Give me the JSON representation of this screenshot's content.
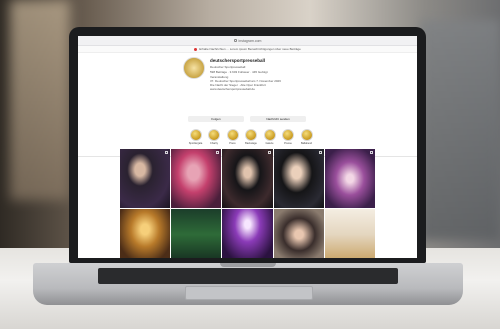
{
  "browser": {
    "url": "instagram.com"
  },
  "notice": {
    "text": "Erhalte Nachrichten ... Lorem ipsum Benachrichtigungen über neue Beiträge"
  },
  "profile": {
    "username": "deutschersportpresseball",
    "verified": true,
    "lines": [
      "Deutscher Sportpresseball",
      "598 Beiträge · 3.603 Follower · 445 Gefolgt",
      "Veranstaltung",
      "37. Deutscher Sportpresseball am 7. November 2026",
      "Die Nacht der Sieger · Alte Oper Frankfurt",
      "www.deutschersportpresseball.de"
    ],
    "follow_label": "Folgen",
    "message_label": "Nachricht senden"
  },
  "highlights": [
    {
      "label": "Sportlergala"
    },
    {
      "label": "Charity"
    },
    {
      "label": "Press"
    },
    {
      "label": "Backstage"
    },
    {
      "label": "Galerie"
    },
    {
      "label": "Presse"
    },
    {
      "label": "Ballabend"
    }
  ],
  "tabs": [
    "posts",
    "reels",
    "tagged"
  ],
  "posts": [
    {
      "subject": "Mann im Smoking mit Pokal"
    },
    {
      "subject": "Frau im pinken Kleid"
    },
    {
      "subject": "Paar im Abendkleid"
    },
    {
      "subject": "Zwei Männer im Smoking"
    },
    {
      "subject": "Festliche Tischdekoration"
    },
    {
      "subject": "Bühne mit goldenen Lichtern"
    },
    {
      "subject": "Weihnachtsbaum"
    },
    {
      "subject": "Bühnenshow mit Lichteffekten"
    },
    {
      "subject": "Gruppenfoto Gäste"
    },
    {
      "subject": "Dekorierte Gala-Tafel"
    }
  ],
  "colors": {
    "gold": "#c99a1e",
    "laptop_bezel": "#1b1c1e",
    "aluminum": "#c3c4c7"
  }
}
